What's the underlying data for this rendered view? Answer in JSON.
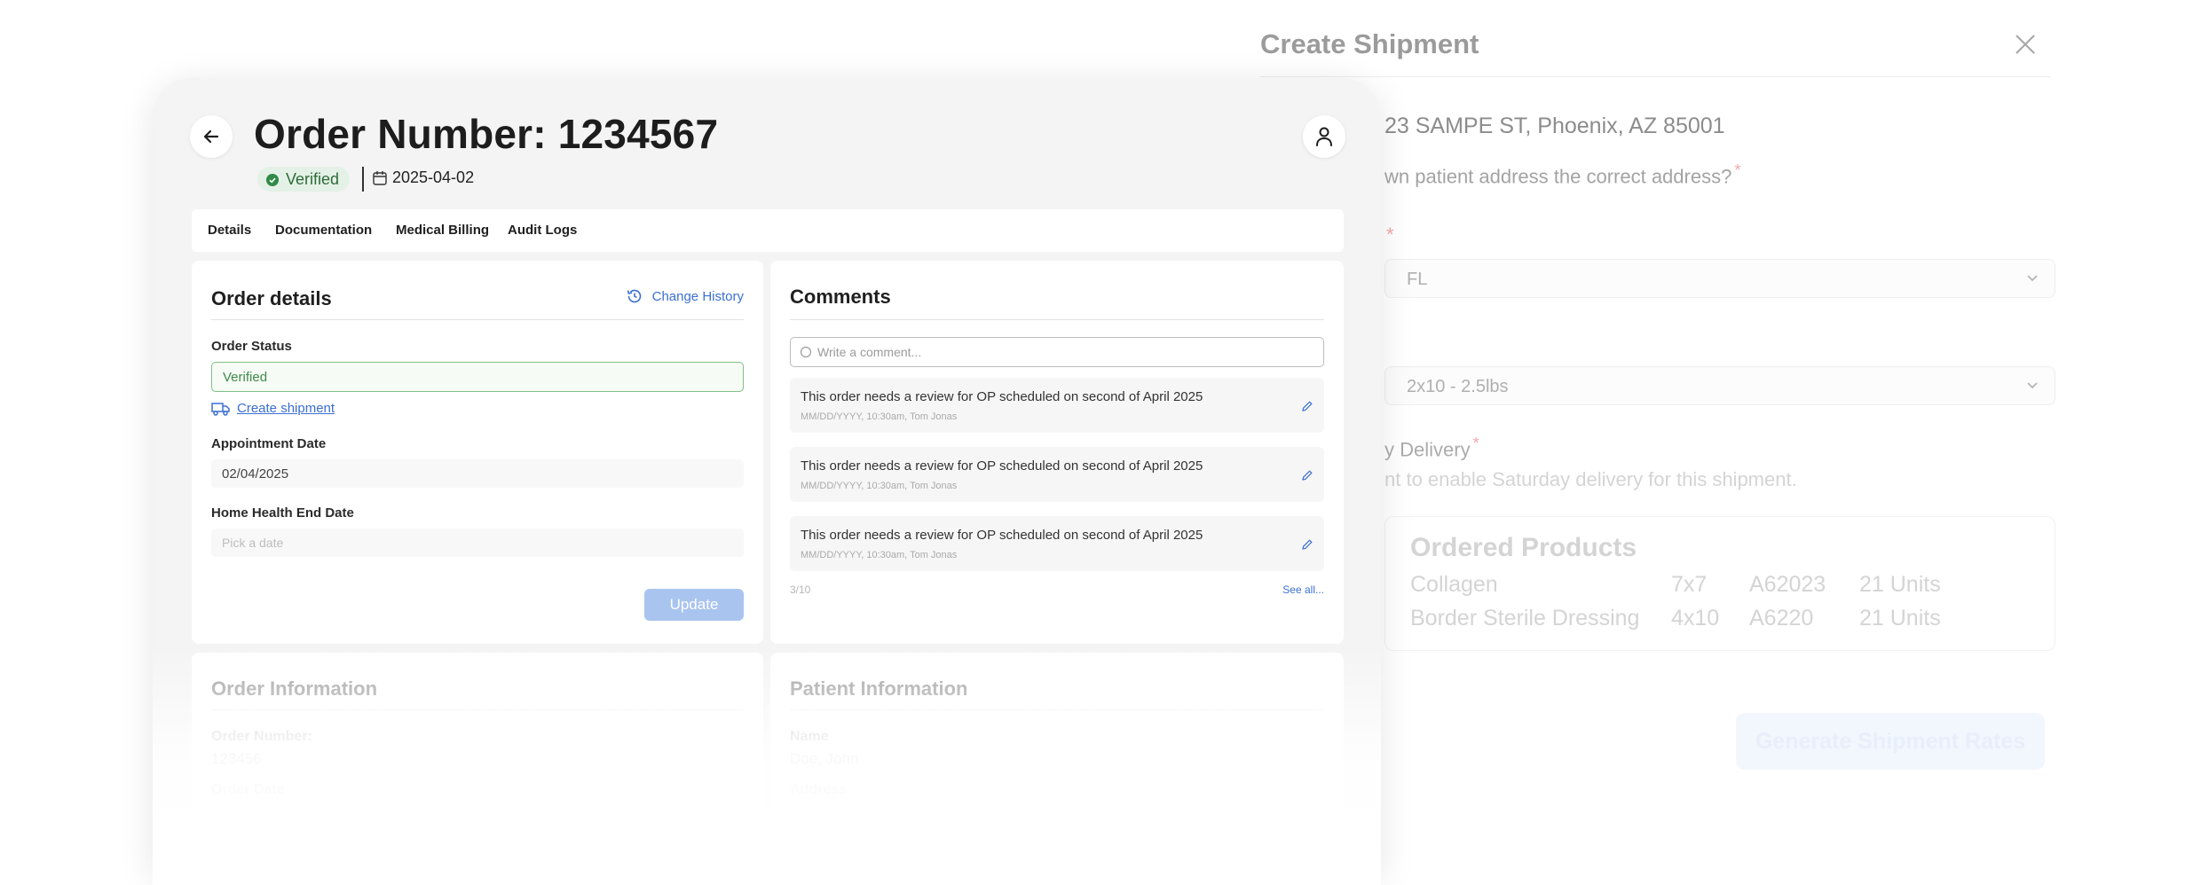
{
  "shipment": {
    "title": "Create Shipment",
    "address": "23 SAMPE ST, Phoenix, AZ 85001",
    "address_question": "wn patient address the correct address?",
    "state_value": "FL",
    "package_value": "2x10 - 2.5lbs",
    "saturday_label": "y Delivery",
    "saturday_hint": "nt to enable Saturday delivery for this shipment.",
    "required_mark": "*",
    "products_title": "Ordered Products",
    "products": [
      {
        "name": "Collagen",
        "size": "7x7",
        "code": "A62023",
        "qty": "21 Units"
      },
      {
        "name": "Border Sterile Dressing",
        "size": "4x10",
        "code": "A6220",
        "qty": "21 Units"
      }
    ],
    "generate_label": "Generate Shipment Rates"
  },
  "order": {
    "title": "Order Number: 1234567",
    "status_badge": "Verified",
    "date": "2025-04-02",
    "tabs": [
      "Details",
      "Documentation",
      "Medical Billing",
      "Audit Logs"
    ],
    "details": {
      "heading": "Order details",
      "change_history": "Change History",
      "order_status_label": "Order Status",
      "order_status_value": "Verified",
      "create_shipment": "Create shipment",
      "appointment_label": "Appointment Date",
      "appointment_value": "02/04/2025",
      "home_health_label": "Home Health End Date",
      "home_health_placeholder": "Pick a date",
      "update_label": "Update"
    },
    "comments": {
      "heading": "Comments",
      "placeholder": "Write a comment...",
      "items": [
        {
          "text": "This order needs a review for OP scheduled on second of April 2025",
          "meta": "MM/DD/YYYY, 10:30am, Tom Jonas"
        },
        {
          "text": "This order needs a review for OP scheduled on second of April 2025",
          "meta": "MM/DD/YYYY, 10:30am, Tom Jonas"
        },
        {
          "text": "This order needs a review for OP scheduled on second of April 2025",
          "meta": "MM/DD/YYYY, 10:30am, Tom Jonas"
        }
      ],
      "count": "3/10",
      "see_all": "See all..."
    },
    "order_information": {
      "heading": "Order Information",
      "number_label": "Order Number:",
      "number_value": "123456",
      "next_label": "Order Date"
    },
    "patient_information": {
      "heading": "Patient Information",
      "name_label": "Name",
      "name_value": "Doe, John",
      "next_label": "Address"
    }
  },
  "colors": {
    "accent_blue": "#3b6fd3",
    "verified_green": "#2f8a45",
    "update_button": "#a9c4ef"
  }
}
